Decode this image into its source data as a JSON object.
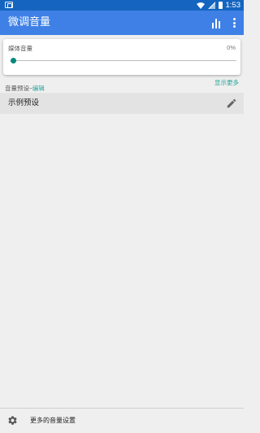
{
  "status_bar": {
    "time": "1:53",
    "icons": [
      "notification-icon",
      "wifi-icon",
      "signal-icon",
      "battery-icon"
    ]
  },
  "app_bar": {
    "title": "微调音量",
    "actions": [
      "equalizer-icon",
      "more-vert-icon"
    ],
    "color": "#3f80e6"
  },
  "media_volume": {
    "label": "媒体音量",
    "percent_text": "0%",
    "level": 0
  },
  "show_more": "显示更多",
  "presets": {
    "header": "音量预设–",
    "edit_link": "编辑",
    "items": [
      {
        "name": "示例预设"
      }
    ]
  },
  "bottom": {
    "label": "更多的音量设置"
  },
  "colors": {
    "accent": "#26a69a",
    "slider": "#00897b",
    "status_bar": "#1565c0"
  }
}
